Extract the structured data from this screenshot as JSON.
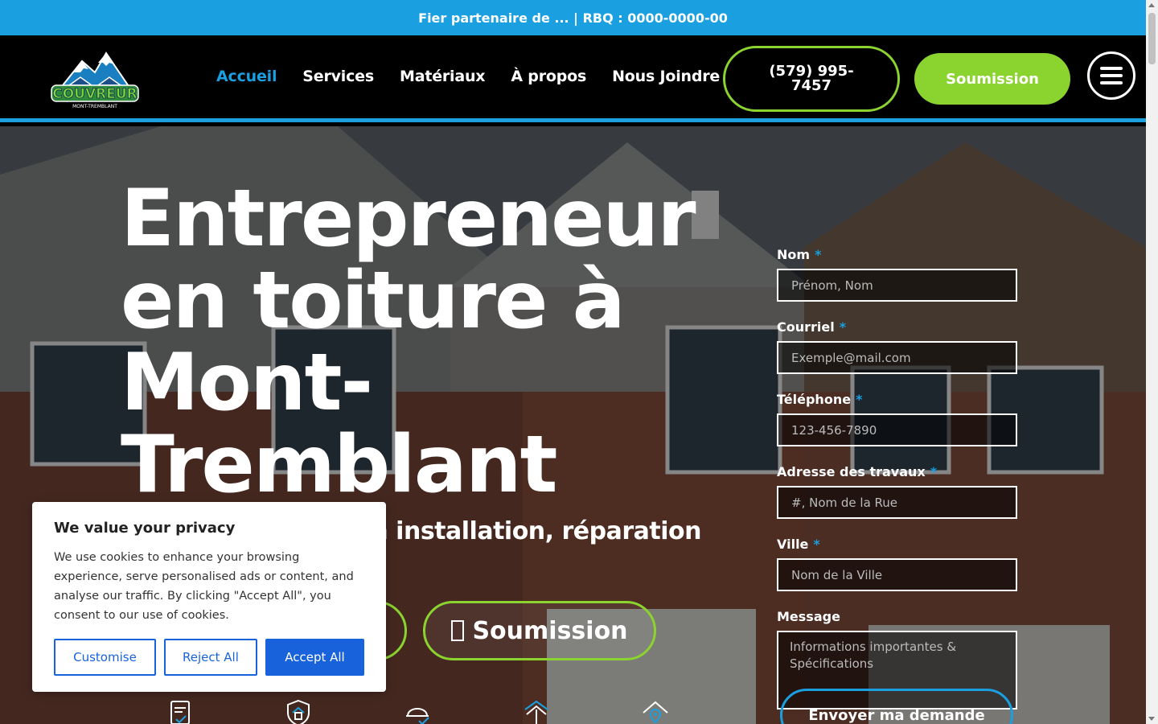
{
  "topbar": {
    "text": "Fier partenaire de ... | RBQ : 0000-0000-00"
  },
  "header": {
    "logo_text": "COUVREUR",
    "logo_subtext": "MONT-TREMBLANT",
    "nav": [
      {
        "label": "Accueil",
        "active": true
      },
      {
        "label": "Services",
        "active": false
      },
      {
        "label": "Matériaux",
        "active": false
      },
      {
        "label": "À propos",
        "active": false
      },
      {
        "label": "Nous Joindre",
        "active": false
      }
    ],
    "phone": "(579) 995-7457",
    "quote_button": "Soumission"
  },
  "hero": {
    "title": "Entrepreneur en toiture à Mont-Tremblant",
    "subtitle": "en installation, réparation",
    "cta_button": "Soumission"
  },
  "form": {
    "fields": [
      {
        "label": "Nom",
        "required": true,
        "placeholder": "Prénom, Nom"
      },
      {
        "label": "Courriel",
        "required": true,
        "placeholder": "Exemple@mail.com"
      },
      {
        "label": "Téléphone",
        "required": true,
        "placeholder": "123-456-7890"
      },
      {
        "label": "Adresse des travaux",
        "required": true,
        "placeholder": "#, Nom de la Rue"
      },
      {
        "label": "Ville",
        "required": true,
        "placeholder": "Nom de la Ville"
      }
    ],
    "message_label": "Message",
    "message_placeholder": "Informations importantes & Spécifications",
    "submit": "Envoyer ma demande",
    "required_mark": "*"
  },
  "cookie": {
    "title": "We value your privacy",
    "body": "We use cookies to enhance your browsing experience, serve personalised ads or content, and analyse our traffic. By clicking \"Accept All\", you consent to our use of cookies.",
    "customise": "Customise",
    "reject": "Reject All",
    "accept": "Accept All"
  },
  "colors": {
    "accent_blue": "#1a9fe0",
    "accent_green": "#8bd32f",
    "cookie_blue": "#1863dc"
  },
  "feature_icons": [
    "document-check-icon",
    "shield-home-icon",
    "helmet-check-icon",
    "roof-arrow-icon",
    "home-location-icon"
  ]
}
